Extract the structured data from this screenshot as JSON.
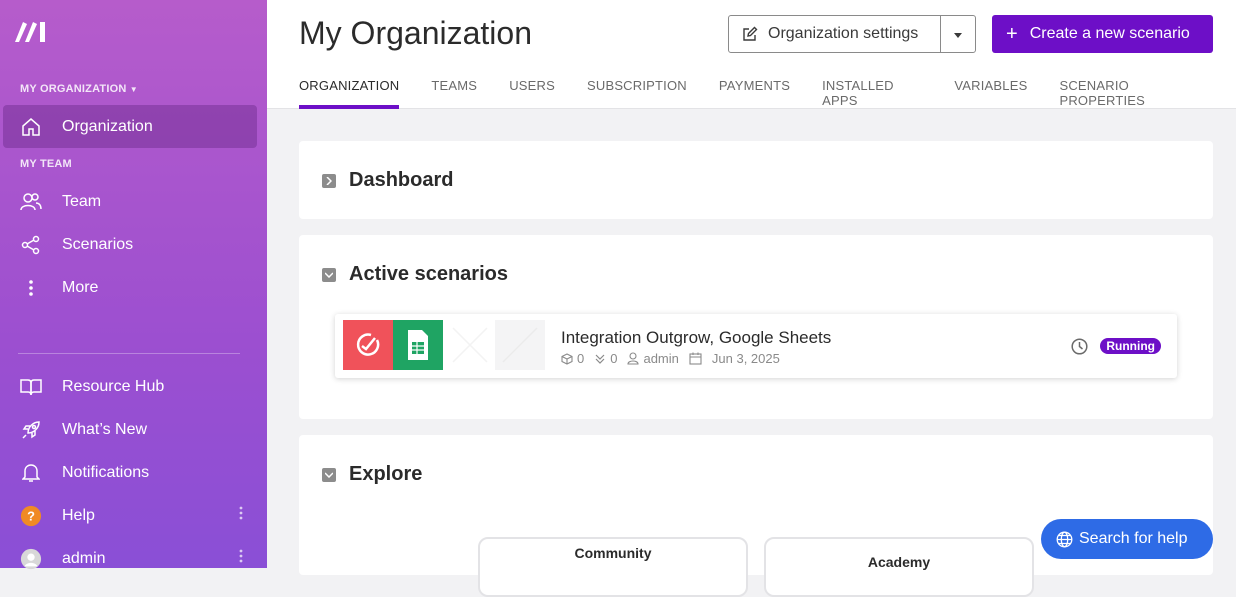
{
  "sidebar": {
    "org_section": "MY ORGANIZATION",
    "team_section": "MY TEAM",
    "items": [
      {
        "label": "Organization"
      },
      {
        "label": "Team"
      },
      {
        "label": "Scenarios"
      },
      {
        "label": "More"
      },
      {
        "label": "Resource Hub"
      },
      {
        "label": "What’s New"
      },
      {
        "label": "Notifications"
      },
      {
        "label": "Help"
      },
      {
        "label": "admin"
      }
    ]
  },
  "header": {
    "title": "My Organization",
    "org_settings_label": "Organization settings",
    "create_label": "Create a new scenario",
    "tabs": [
      {
        "label": "ORGANIZATION"
      },
      {
        "label": "TEAMS"
      },
      {
        "label": "USERS"
      },
      {
        "label": "SUBSCRIPTION"
      },
      {
        "label": "PAYMENTS"
      },
      {
        "label": "INSTALLED APPS"
      },
      {
        "label": "VARIABLES"
      },
      {
        "label": "SCENARIO PROPERTIES"
      }
    ]
  },
  "sections": {
    "dashboard": "Dashboard",
    "active": "Active scenarios",
    "explore": "Explore"
  },
  "scenario": {
    "name": "Integration Outgrow, Google Sheets",
    "ops": "0",
    "data": "0",
    "owner": "admin",
    "date": "Jun 3, 2025",
    "status": "Running"
  },
  "explore_cards": [
    {
      "label": "Community"
    },
    {
      "label": "Academy"
    }
  ],
  "help_button": "Search for help",
  "colors": {
    "accent": "#6d0fc7",
    "help": "#2e6be6"
  }
}
